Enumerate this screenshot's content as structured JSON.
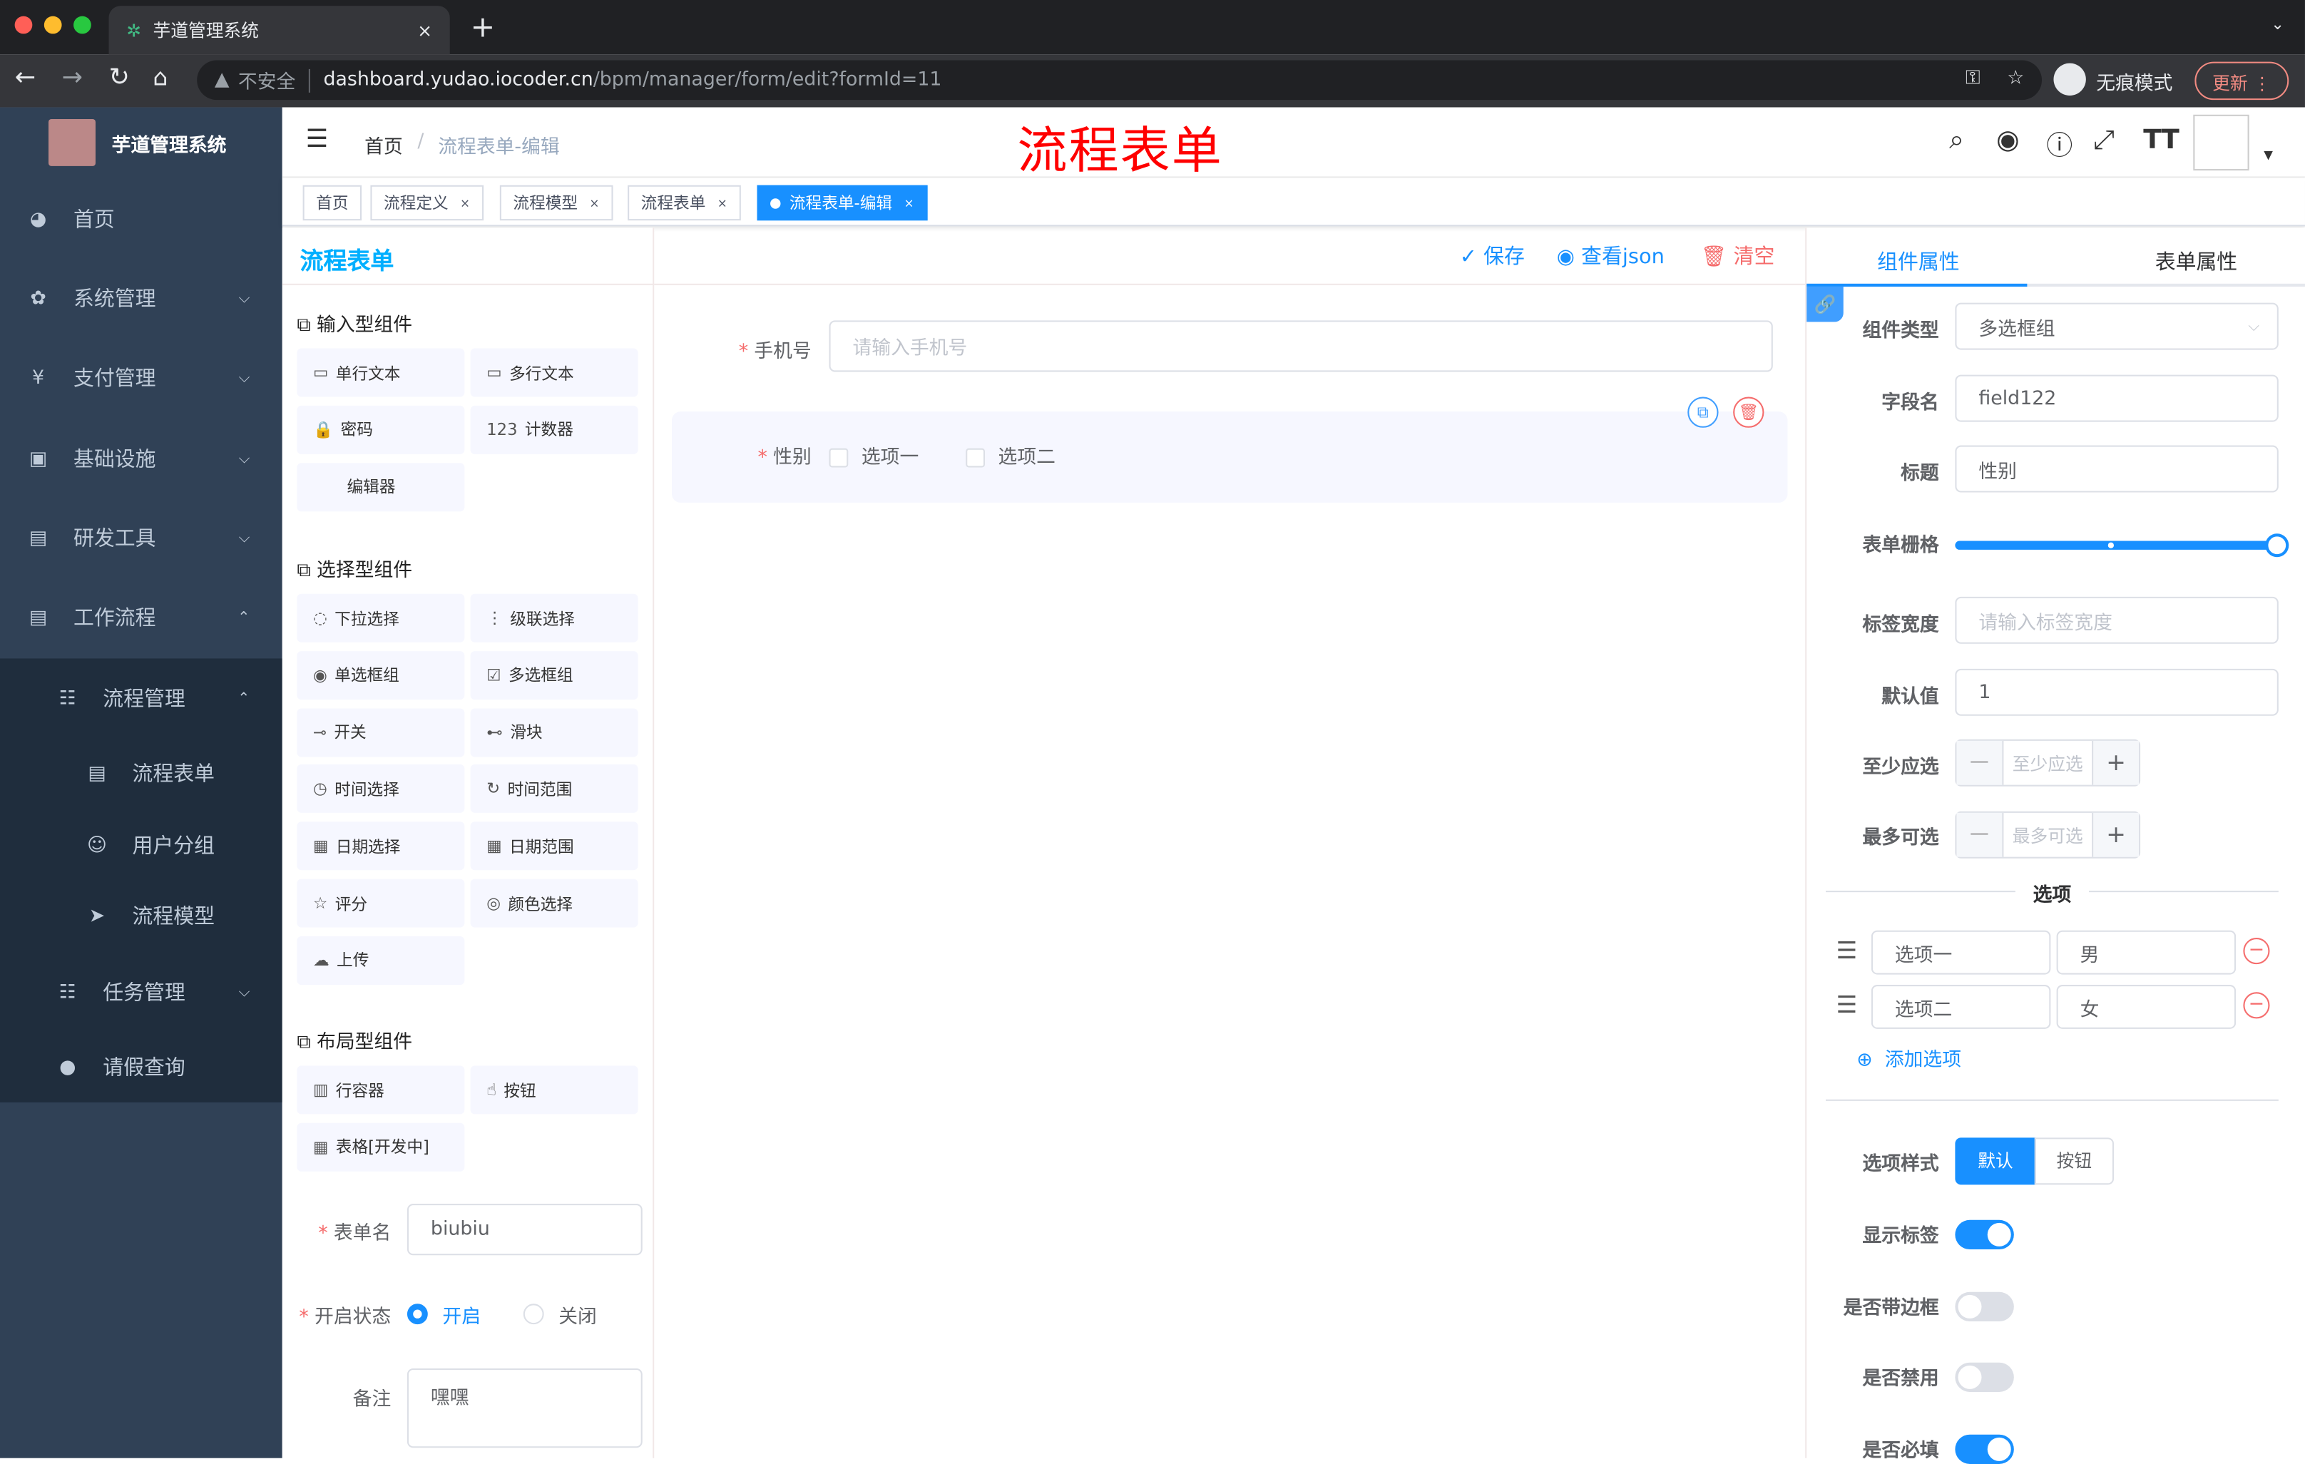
{
  "browser": {
    "tab_title": "芋道管理系统",
    "tab_close": "×",
    "new_tab": "+",
    "insecure": "不安全",
    "url_host": "dashboard.yudao.iocoder.cn",
    "url_path": "/bpm/manager/form/edit?formId=11",
    "incognito": "无痕模式",
    "update": "更新"
  },
  "sidebar": {
    "logo_title": "芋道管理系统",
    "items": [
      {
        "label": "首页",
        "icon": "dashboard-icon"
      },
      {
        "label": "系统管理",
        "icon": "gear-icon"
      },
      {
        "label": "支付管理",
        "icon": "yen-icon"
      },
      {
        "label": "基础设施",
        "icon": "monitor-icon"
      },
      {
        "label": "研发工具",
        "icon": "toolbox-icon"
      },
      {
        "label": "工作流程",
        "icon": "toolbox-icon"
      },
      {
        "label": "流程管理",
        "icon": "tree-icon"
      },
      {
        "label": "流程表单",
        "icon": "form-icon"
      },
      {
        "label": "用户分组",
        "icon": "people-icon"
      },
      {
        "label": "流程模型",
        "icon": "send-icon"
      },
      {
        "label": "任务管理",
        "icon": "tree-icon"
      },
      {
        "label": "请假查询",
        "icon": "user-icon"
      }
    ]
  },
  "header": {
    "breadcrumb_home": "首页",
    "breadcrumb_sep": "/",
    "breadcrumb_current": "流程表单-编辑",
    "overlay_title": "流程表单"
  },
  "tags": [
    {
      "label": "首页"
    },
    {
      "label": "流程定义"
    },
    {
      "label": "流程模型"
    },
    {
      "label": "流程表单"
    },
    {
      "label": "流程表单-编辑"
    }
  ],
  "toolbar": {
    "title": "流程表单",
    "save": "保存",
    "view_json": "查看json",
    "clear": "清空"
  },
  "components": {
    "input_group": "输入型组件",
    "input": [
      {
        "label": "单行文本",
        "icon": "▭"
      },
      {
        "label": "多行文本",
        "icon": "▭"
      },
      {
        "label": "密码",
        "icon": "🔒"
      },
      {
        "label": "计数器",
        "icon": "123"
      },
      {
        "label": "编辑器",
        "icon": ""
      }
    ],
    "select_group": "选择型组件",
    "select": [
      {
        "label": "下拉选择",
        "icon": "◌"
      },
      {
        "label": "级联选择",
        "icon": "⋮"
      },
      {
        "label": "单选框组",
        "icon": "◉"
      },
      {
        "label": "多选框组",
        "icon": "☑"
      },
      {
        "label": "开关",
        "icon": "⊸"
      },
      {
        "label": "滑块",
        "icon": "⊷"
      },
      {
        "label": "时间选择",
        "icon": "◷"
      },
      {
        "label": "时间范围",
        "icon": "↻"
      },
      {
        "label": "日期选择",
        "icon": "▦"
      },
      {
        "label": "日期范围",
        "icon": "▦"
      },
      {
        "label": "评分",
        "icon": "☆"
      },
      {
        "label": "颜色选择",
        "icon": "◎"
      },
      {
        "label": "上传",
        "icon": "☁"
      }
    ],
    "layout_group": "布局型组件",
    "layout": [
      {
        "label": "行容器",
        "icon": "▥"
      },
      {
        "label": "按钮",
        "icon": "☝"
      },
      {
        "label": "表格[开发中]",
        "icon": "▦"
      }
    ]
  },
  "form_meta": {
    "name_label": "表单名",
    "name_value": "biubiu",
    "status_label": "开启状态",
    "status_on": "开启",
    "status_off": "关闭",
    "status_selected": "开启",
    "remark_label": "备注",
    "remark_value": "嘿嘿"
  },
  "canvas": {
    "phone_label": "手机号",
    "phone_placeholder": "请输入手机号",
    "gender_label": "性别",
    "options": [
      "选项一",
      "选项二"
    ]
  },
  "props": {
    "tab_component": "组件属性",
    "tab_form": "表单属性",
    "active_tab": "组件属性",
    "type_label": "组件类型",
    "type_value": "多选框组",
    "field_label": "字段名",
    "field_value": "field122",
    "title_label": "标题",
    "title_value": "性别",
    "grid_label": "表单栅格",
    "grid_value": 24,
    "grid_max": 24,
    "label_width_label": "标签宽度",
    "label_width_placeholder": "请输入标签宽度",
    "default_label": "默认值",
    "default_value": "1",
    "min_label": "至少应选",
    "min_placeholder": "至少应选",
    "max_label": "最多可选",
    "max_placeholder": "最多可选",
    "minus": "—",
    "plus": "+",
    "options_divider": "选项",
    "options": [
      {
        "label": "选项一",
        "value": "男"
      },
      {
        "label": "选项二",
        "value": "女"
      }
    ],
    "add_option": "添加选项",
    "style_label": "选项样式",
    "style_default": "默认",
    "style_button": "按钮",
    "show_label": "显示标签",
    "show_label_on": true,
    "border_label": "是否带边框",
    "border_on": false,
    "disabled_label": "是否禁用",
    "disabled_on": false,
    "required_label": "是否必填",
    "required_on": true
  },
  "colors": {
    "accent": "#1890ff",
    "sidebar": "#304156",
    "danger": "#f56c6c",
    "title_red": "#ff0000"
  }
}
